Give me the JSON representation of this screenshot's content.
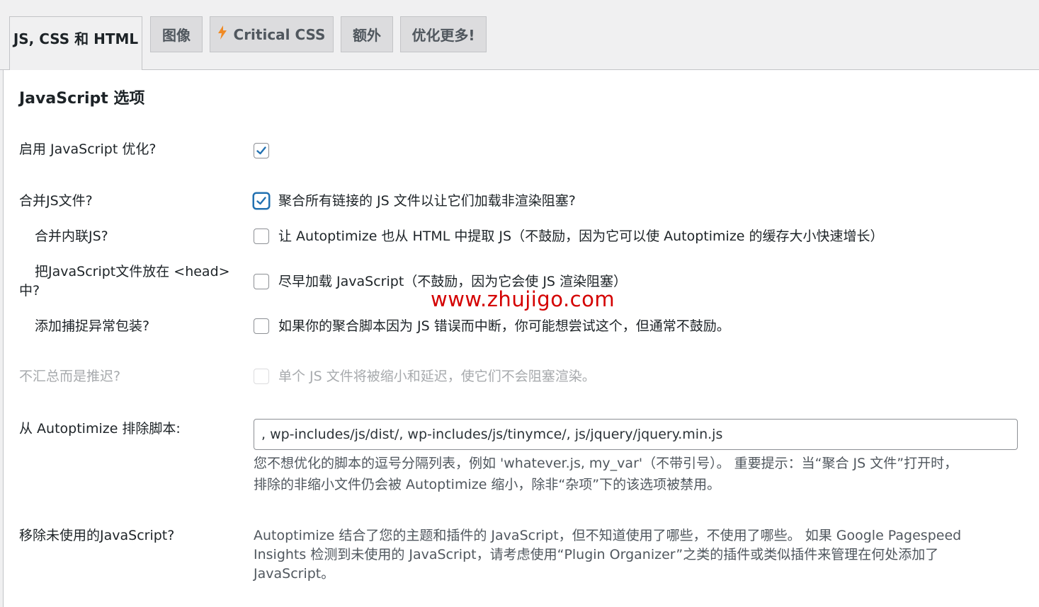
{
  "tabs": [
    {
      "label": "JS, CSS 和 HTML",
      "active": true
    },
    {
      "label": "图像",
      "active": false
    },
    {
      "label": "Critical CSS",
      "active": false,
      "icon": "lightning-icon",
      "icon_color": "#f08a24"
    },
    {
      "label": "额外",
      "active": false
    },
    {
      "label": "优化更多!",
      "active": false
    }
  ],
  "section": {
    "title": "JavaScript 选项"
  },
  "settings": {
    "enable_js": {
      "label": "启用 JavaScript 优化?",
      "checked": true
    },
    "aggregate": {
      "label": "合并JS文件?",
      "checked": true,
      "text": "聚合所有链接的 JS 文件以让它们加载非渲染阻塞?"
    },
    "inline": {
      "label": "合并内联JS?",
      "checked": false,
      "text": "让 Autoptimize 也从 HTML 中提取 JS（不鼓励，因为它可以使 Autoptimize 的缓存大小快速增长）"
    },
    "head": {
      "label_line1": "把JavaScript文件放在 <head>",
      "label_line2": "中?",
      "checked": false,
      "text": "尽早加载 JavaScript（不鼓励，因为它会使 JS 渲染阻塞）"
    },
    "trycatch": {
      "label": "添加捕捉异常包装?",
      "checked": false,
      "text": "如果你的聚合脚本因为 JS 错误而中断，你可能想尝试这个，但通常不鼓励。"
    },
    "defer": {
      "label": "不汇总而是推迟?",
      "checked": false,
      "disabled": true,
      "text": "单个 JS 文件将被缩小和延迟，使它们不会阻塞渲染。"
    },
    "exclude": {
      "label": "从 Autoptimize 排除脚本:",
      "value": ", wp-includes/js/dist/, wp-includes/js/tinymce/, js/jquery/jquery.min.js",
      "desc_line1": "您不想优化的脚本的逗号分隔列表，例如 'whatever.js, my_var'（不带引号）。 重要提示：当“聚合 JS 文件”打开时，",
      "desc_line2": "排除的非缩小文件仍会被 Autoptimize 缩小，除非“杂项”下的该选项被禁用。"
    },
    "unused": {
      "label": "移除未使用的JavaScript?",
      "desc_line1": "Autoptimize 结合了您的主题和插件的 JavaScript，但不知道使用了哪些，不使用了哪些。 如果 Google Pagespeed",
      "desc_line2": "Insights 检测到未使用的 JavaScript，请考虑使用“Plugin Organizer”之类的插件或类似插件来管理在何处添加了",
      "desc_line3": "JavaScript。"
    }
  },
  "watermark": "www.zhujigo.com",
  "colors": {
    "accent": "#2271b1",
    "watermark": "#d40000"
  }
}
